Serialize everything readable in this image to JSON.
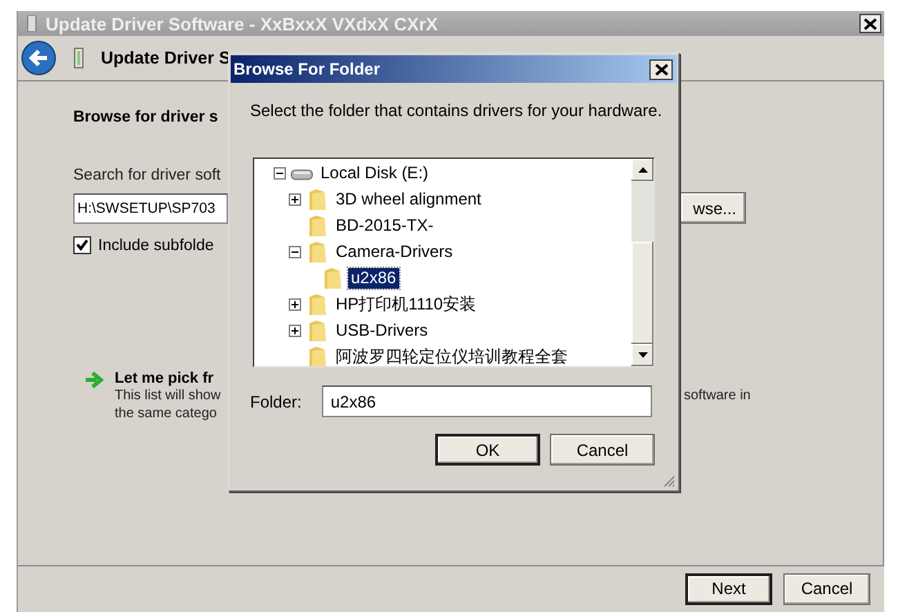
{
  "main_window": {
    "title": "Update Driver Software - XxBxxX VXdxX CXrX",
    "header_title": "Update Driver S",
    "heading": "Browse for driver s",
    "search_label": "Search for driver soft",
    "path_field": {
      "value": "H:\\SWSETUP\\SP703"
    },
    "browse_button": "wse...",
    "include_subfolders": {
      "label": "Include subfolde",
      "checked": true
    },
    "pick_option": {
      "title": "Let me pick fr",
      "lines": [
        "This list will show",
        "the same catego"
      ],
      "line_tail": "software in"
    },
    "buttons": [
      {
        "label": "Next",
        "default": true
      },
      {
        "label": "Cancel",
        "default": false
      }
    ]
  },
  "dialog": {
    "title": "Browse For Folder",
    "instruction": "Select the folder that contains drivers for your hardware.",
    "tree": [
      {
        "label": "Local Disk (E:)",
        "kind": "drive",
        "expanded": true,
        "selected": false,
        "children": [
          {
            "label": "3D wheel alignment",
            "kind": "folder",
            "expanded": false,
            "selected": false
          },
          {
            "label": "BD-2015-TX-",
            "kind": "folder",
            "selected": false
          },
          {
            "label": "Camera-Drivers",
            "kind": "folder",
            "expanded": true,
            "selected": false,
            "children": [
              {
                "label": "u2x86",
                "kind": "folder",
                "selected": true
              }
            ]
          },
          {
            "label": "HP打印机1110安装",
            "kind": "folder",
            "expanded": false,
            "selected": false
          },
          {
            "label": "USB-Drivers",
            "kind": "folder",
            "expanded": false,
            "selected": false
          },
          {
            "label": "阿波罗四轮定位仪培训教程全套",
            "kind": "folder",
            "selected": false
          }
        ]
      }
    ],
    "folder_label": "Folder:",
    "folder_field": {
      "value": "u2x86"
    },
    "buttons": [
      {
        "label": "OK",
        "default": true
      },
      {
        "label": "Cancel",
        "default": false
      }
    ]
  }
}
